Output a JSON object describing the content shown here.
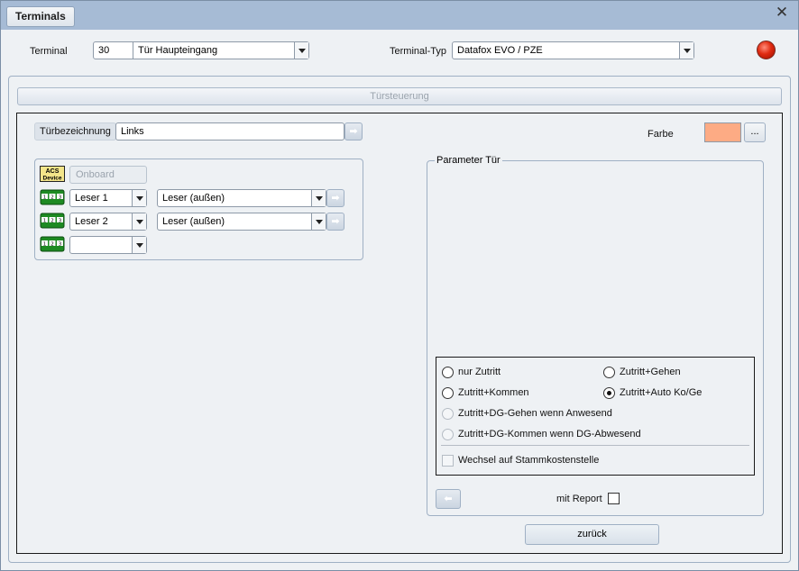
{
  "window": {
    "title": "Terminals",
    "close_symbol": "✕"
  },
  "header": {
    "terminal_label": "Terminal",
    "terminal_number": "30",
    "terminal_name": "Tür Haupteingang",
    "terminal_type_label": "Terminal-Typ",
    "terminal_type": "Datafox EVO / PZE",
    "status_led_color": "#e02a10"
  },
  "section": {
    "title": "Türsteuerung"
  },
  "door": {
    "name_label": "Türbezeichnung",
    "name_value": "Links",
    "color_label": "Farbe",
    "color_value": "#fdab84",
    "color_button_label": "..."
  },
  "devices": {
    "acs_icon_text": [
      "ACS",
      "Device"
    ],
    "onboard_label": "Onboard",
    "reader_icon_digits": [
      "1",
      "2",
      "3"
    ],
    "rows": [
      {
        "reader": "Leser 1",
        "type": "Leser (außen)"
      },
      {
        "reader": "Leser 2",
        "type": "Leser (außen)"
      },
      {
        "reader": ""
      }
    ]
  },
  "parameter": {
    "title": "Parameter Tür",
    "options": [
      {
        "label": "nur Zutritt",
        "checked": false,
        "enabled": true
      },
      {
        "label": "Zutritt+Gehen",
        "checked": false,
        "enabled": true
      },
      {
        "label": "Zutritt+Kommen",
        "checked": false,
        "enabled": true
      },
      {
        "label": "Zutritt+Auto Ko/Ge",
        "checked": true,
        "enabled": true
      },
      {
        "label": "Zutritt+DG-Gehen wenn Anwesend",
        "checked": false,
        "enabled": false
      },
      {
        "label": "Zutritt+DG-Kommen wenn DG-Abwesend",
        "checked": false,
        "enabled": false
      }
    ],
    "cost_center_label": "Wechsel auf Stammkostenstelle",
    "report_label": "mit Report"
  },
  "footer": {
    "back_label": "zurück"
  }
}
